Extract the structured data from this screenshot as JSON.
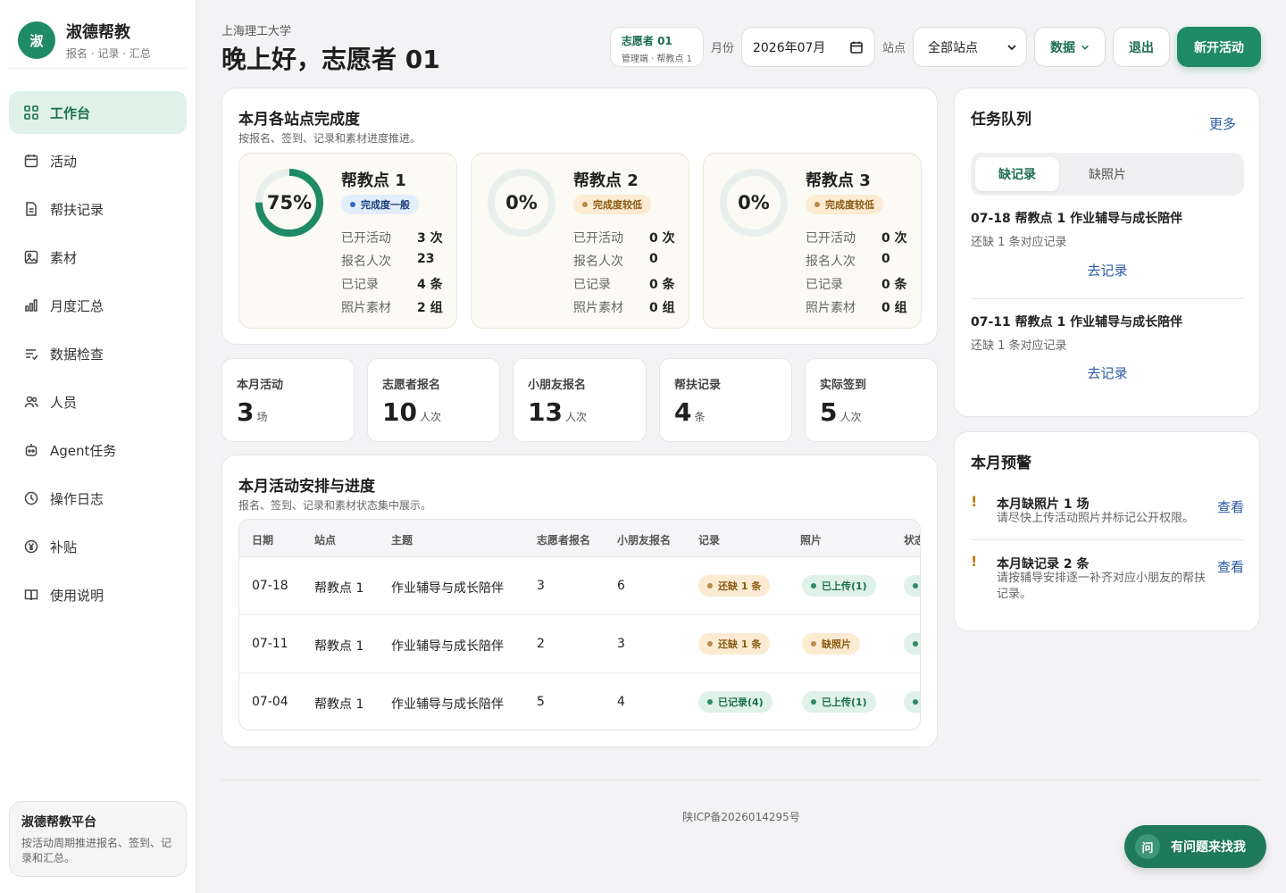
{
  "brand": {
    "logo": "淑",
    "title": "淑德帮教",
    "subtitle": "报名 · 记录 · 汇总"
  },
  "sidebar": {
    "items": [
      {
        "label": "工作台",
        "icon": "dashboard-icon"
      },
      {
        "label": "活动",
        "icon": "calendar-icon"
      },
      {
        "label": "帮扶记录",
        "icon": "document-icon"
      },
      {
        "label": "素材",
        "icon": "image-icon"
      },
      {
        "label": "月度汇总",
        "icon": "bar-chart-icon"
      },
      {
        "label": "数据检查",
        "icon": "list-check-icon"
      },
      {
        "label": "人员",
        "icon": "users-icon"
      },
      {
        "label": "Agent任务",
        "icon": "robot-icon"
      },
      {
        "label": "操作日志",
        "icon": "clock-icon"
      },
      {
        "label": "补贴",
        "icon": "yen-icon"
      },
      {
        "label": "使用说明",
        "icon": "book-icon"
      }
    ],
    "card": {
      "title": "淑德帮教平台",
      "desc": "按活动周期推进报名、签到、记录和汇总。"
    }
  },
  "header": {
    "school": "上海理工大学",
    "greeting": "晚上好，志愿者 01"
  },
  "controls": {
    "user_name": "志愿者 01",
    "user_role": "管理端 · 帮教点 1",
    "month_label": "月份",
    "month_value": "2026年07月",
    "site_label": "站点",
    "site_value": "全部站点",
    "data_btn": "数据",
    "logout_btn": "退出",
    "new_btn": "新开活动"
  },
  "completion": {
    "title": "本月各站点完成度",
    "subtitle": "按报名、签到、记录和素材进度推进。",
    "sites": [
      {
        "name": "帮教点 1",
        "percent": "75%",
        "fraction": 0.75,
        "status": "完成度一般",
        "status_kind": "info",
        "rows": [
          {
            "k": "已开活动",
            "v": "3 次"
          },
          {
            "k": "报名人次",
            "v": "23"
          },
          {
            "k": "已记录",
            "v": "4 条"
          },
          {
            "k": "照片素材",
            "v": "2 组"
          }
        ]
      },
      {
        "name": "帮教点 2",
        "percent": "0%",
        "fraction": 0,
        "status": "完成度较低",
        "status_kind": "warn",
        "rows": [
          {
            "k": "已开活动",
            "v": "0 次"
          },
          {
            "k": "报名人次",
            "v": "0"
          },
          {
            "k": "已记录",
            "v": "0 条"
          },
          {
            "k": "照片素材",
            "v": "0 组"
          }
        ]
      },
      {
        "name": "帮教点 3",
        "percent": "0%",
        "fraction": 0,
        "status": "完成度较低",
        "status_kind": "warn",
        "rows": [
          {
            "k": "已开活动",
            "v": "0 次"
          },
          {
            "k": "报名人次",
            "v": "0"
          },
          {
            "k": "已记录",
            "v": "0 条"
          },
          {
            "k": "照片素材",
            "v": "0 组"
          }
        ]
      }
    ]
  },
  "stats": [
    {
      "label": "本月活动",
      "value": "3",
      "unit": "场"
    },
    {
      "label": "志愿者报名",
      "value": "10",
      "unit": "人次"
    },
    {
      "label": "小朋友报名",
      "value": "13",
      "unit": "人次"
    },
    {
      "label": "帮扶记录",
      "value": "4",
      "unit": "条"
    },
    {
      "label": "实际签到",
      "value": "5",
      "unit": "人次"
    }
  ],
  "schedule": {
    "title": "本月活动安排与进度",
    "subtitle": "报名、签到、记录和素材状态集中展示。",
    "headers": [
      "日期",
      "站点",
      "主题",
      "志愿者报名",
      "小朋友报名",
      "记录",
      "照片",
      "状态"
    ],
    "rows": [
      {
        "date": "07-18",
        "site": "帮教点 1",
        "topic": "作业辅导与成长陪伴",
        "vol": "3",
        "kid": "6",
        "record": "还缺 1 条",
        "record_kind": "warn",
        "photo": "已上传(1)",
        "photo_kind": "ok"
      },
      {
        "date": "07-11",
        "site": "帮教点 1",
        "topic": "作业辅导与成长陪伴",
        "vol": "2",
        "kid": "3",
        "record": "还缺 1 条",
        "record_kind": "warn",
        "photo": "缺照片",
        "photo_kind": "warn"
      },
      {
        "date": "07-04",
        "site": "帮教点 1",
        "topic": "作业辅导与成长陪伴",
        "vol": "5",
        "kid": "4",
        "record": "已记录(4)",
        "record_kind": "ok",
        "photo": "已上传(1)",
        "photo_kind": "ok"
      }
    ]
  },
  "tasks": {
    "title": "任务队列",
    "more": "更多",
    "tabs": [
      "缺记录",
      "缺照片"
    ],
    "items": [
      {
        "title": "07-18 帮教点 1 作业辅导与成长陪伴",
        "desc": "还缺 1 条对应记录",
        "link": "去记录"
      },
      {
        "title": "07-11 帮教点 1 作业辅导与成长陪伴",
        "desc": "还缺 1 条对应记录",
        "link": "去记录"
      }
    ]
  },
  "alerts": {
    "title": "本月预警",
    "items": [
      {
        "mark": "!",
        "title": "本月缺照片 1 场",
        "desc": "请尽快上传活动照片并标记公开权限。",
        "link": "查看"
      },
      {
        "mark": "!",
        "title": "本月缺记录 2 条",
        "desc": "请按辅导安排逐一补齐对应小朋友的帮扶记录。",
        "link": "查看"
      }
    ]
  },
  "footer": "陕ICP备2026014295号",
  "help": {
    "icon": "问",
    "label": "有问题来找我"
  },
  "colors": {
    "accent": "#1f8a66",
    "accent_light": "#dff1e8",
    "ring_track": "#e8efec"
  }
}
